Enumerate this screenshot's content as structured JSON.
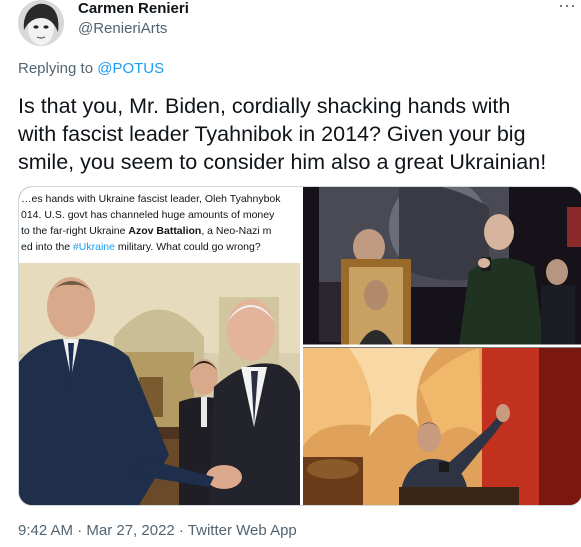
{
  "author": {
    "display_name": "Carmen Renieri",
    "handle": "@RenieriArts"
  },
  "reply": {
    "prefix": "Replying to ",
    "mention": "@POTUS"
  },
  "tweet": {
    "lines": [
      "Is that you, Mr. Biden, cordially shacking hands with",
      "with fascist leader Tyahnibok in 2014? Given your big",
      "smile, you seem to consider him also a great Ukrainian!"
    ]
  },
  "media": {
    "screenshot_text": {
      "line1": "…es hands with Ukraine fascist leader, Oleh Tyahnybok",
      "line2": "014. U.S. govt has channeled huge amounts of money",
      "line3_pre": "to the far-right Ukraine ",
      "line3_bold": "Azov Battalion",
      "line3_post": ", a Neo-Nazi m",
      "line4_pre": "ed into the ",
      "line4_link": "#Ukraine",
      "line4_post": " military. What could go wrong?"
    }
  },
  "footer": {
    "timestamp": "9:42 AM · Mar 27, 2022 · Twitter Web App"
  },
  "icons": {
    "more": "more-icon"
  },
  "colors": {
    "link": "#1d9bf0",
    "secondary_text": "#536471",
    "primary_text": "#0f1419"
  }
}
